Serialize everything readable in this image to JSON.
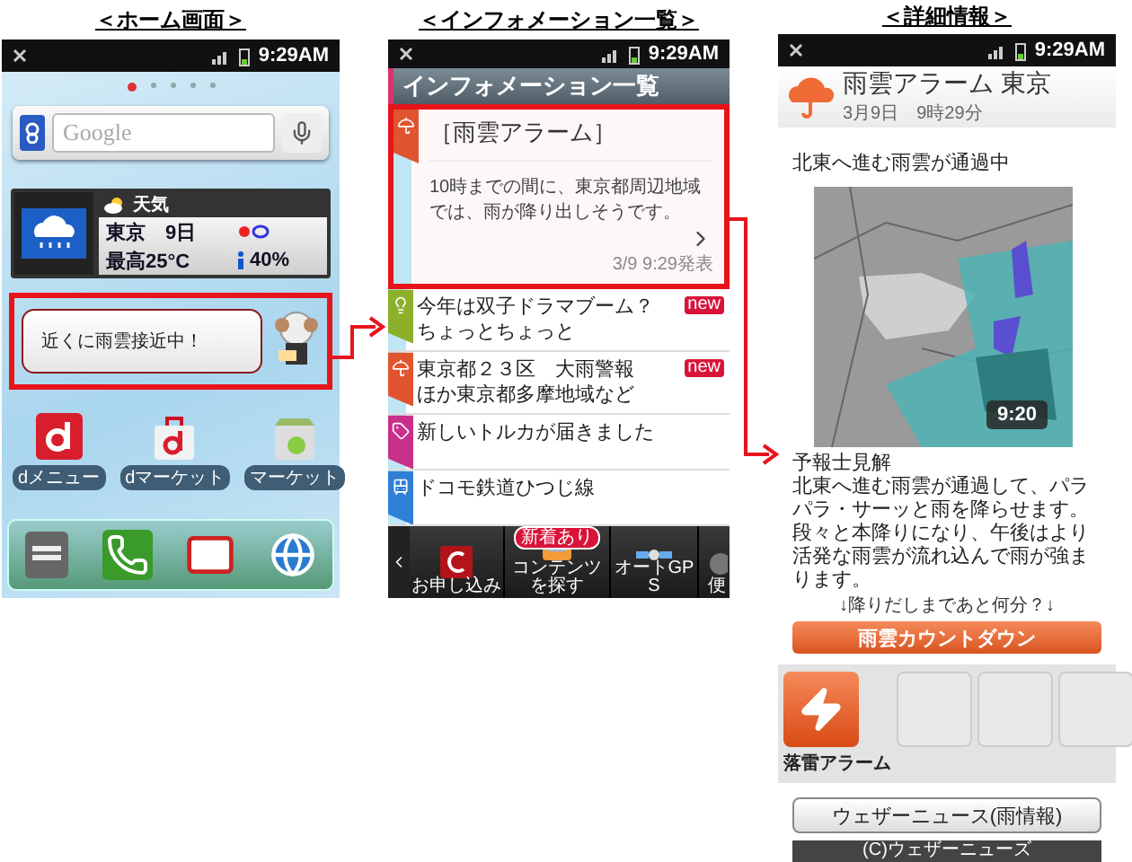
{
  "home": {
    "heading": "＜ホーム画面＞",
    "status_time": "9:29AM",
    "page_dots": [
      {
        "selected": true
      },
      {
        "selected": false
      },
      {
        "selected": false
      },
      {
        "selected": false
      },
      {
        "selected": false
      }
    ],
    "search": {
      "placeholder": "Google"
    },
    "weather": {
      "title": "天気",
      "city": "東京",
      "day": "9日",
      "high": "最高25°C",
      "rain": "40%"
    },
    "bubble": {
      "text": "近くに雨雲接近中！",
      "highlighted": true
    },
    "apps": [
      {
        "kind": "dmenu",
        "label": "dメニュー"
      },
      {
        "kind": "dmarket",
        "label": "dマーケット"
      },
      {
        "kind": "market",
        "label": "マーケット"
      }
    ]
  },
  "info": {
    "heading": "＜インフォメーション一覧＞",
    "status_time": "9:29AM",
    "title": "インフォメーション一覧",
    "featured": {
      "title": "［雨雲アラーム］",
      "body": "10時までの間に、東京都周辺地域では、雨が降り出しそうです。",
      "date": "3/9 9:29発表",
      "color": "#e0552f",
      "highlighted": true
    },
    "items": [
      {
        "lines": [
          "今年は双子ドラマブーム？",
          "ちょっとちょっと"
        ],
        "badge": "new",
        "color": "#8cb02a"
      },
      {
        "lines": [
          "東京都２３区　大雨警報",
          "ほか東京都多摩地域など"
        ],
        "badge": "new",
        "color": "#e0552f"
      },
      {
        "lines": [
          "新しいトルカが届きました"
        ],
        "color": "#c8308a"
      },
      {
        "lines": [
          "ドコモ鉄道ひつじ線"
        ],
        "color": "#2f7fd6"
      }
    ],
    "toolbar": [
      {
        "kind": "apply",
        "label": "お申し込み"
      },
      {
        "kind": "content",
        "label": "コンテンツを探す",
        "badge": "新着あり"
      },
      {
        "kind": "gps",
        "label": "オートGPS"
      },
      {
        "kind": "more",
        "label": "便"
      }
    ]
  },
  "detail": {
    "heading": "＜詳細情報＞",
    "status_time": "9:29AM",
    "title": "雨雲アラーム 東京",
    "date": "3月9日　9時29分",
    "headline": "北東へ進む雨雲が通過中",
    "map_time": "9:20",
    "forecast_title": "予報士見解",
    "forecast": "北東へ進む雨雲が通過して、パラパラ・サーッと雨を降らせます。段々と本降りになり、午後はより活発な雨雲が流れ込んで雨が強まります。",
    "countdown_hint": "↓降りだしまであと何分？↓",
    "countdown_button": "雨雲カウントダウン",
    "tiles": [
      {
        "kind": "lightning",
        "label": "落雷アラーム"
      },
      {
        "kind": "empty"
      },
      {
        "kind": "empty"
      },
      {
        "kind": "empty"
      }
    ],
    "news_button": "ウェザーニュース(雨情報)",
    "footer": "(C)ウェザーニューズ"
  }
}
